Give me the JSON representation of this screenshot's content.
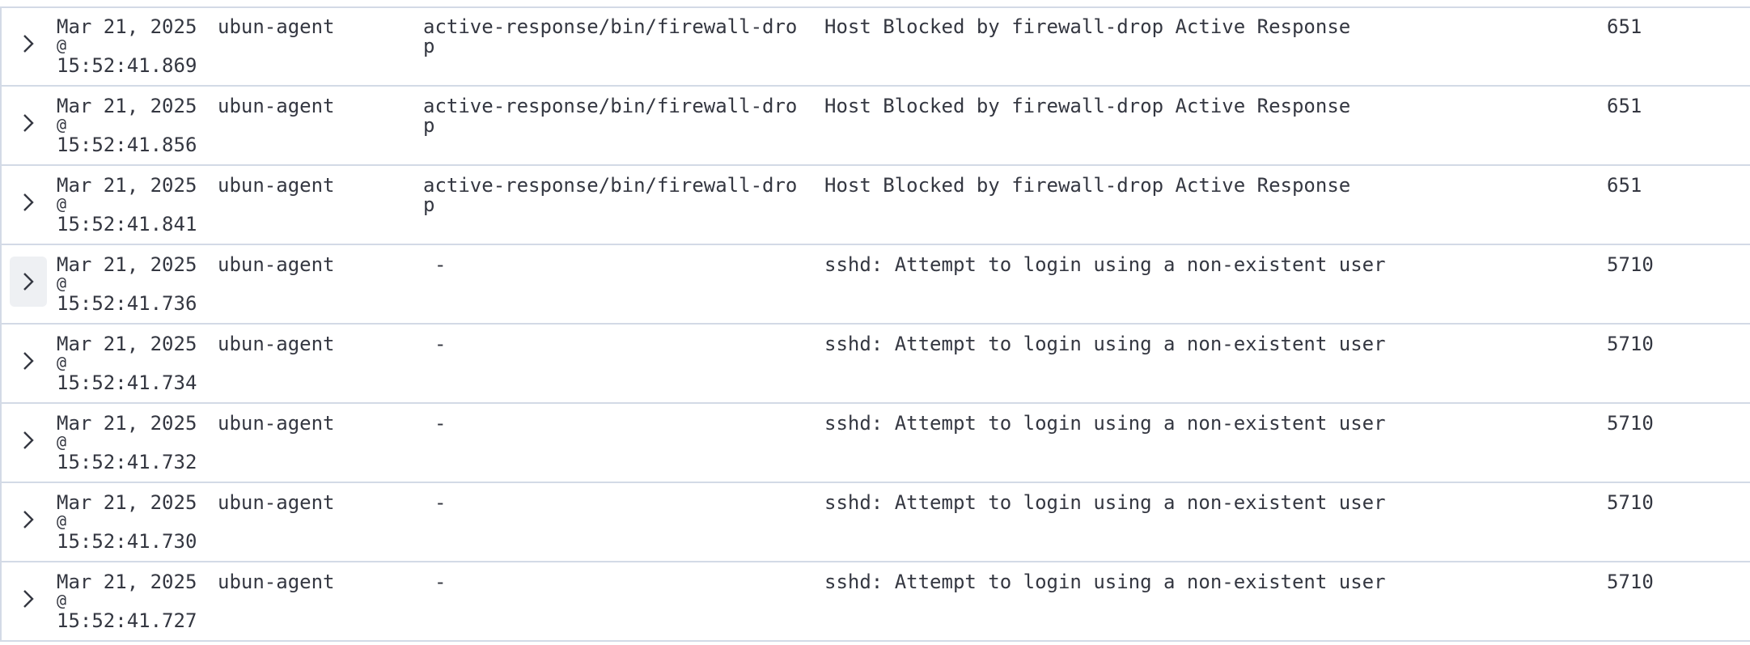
{
  "rows": [
    {
      "date": "Mar 21, 2025",
      "at": "@",
      "time": "15:52:41.869",
      "agent": "ubun-agent",
      "location": "active-response/bin/firewall-drop",
      "description": "Host Blocked by firewall-drop Active Response",
      "rule_id": "651"
    },
    {
      "date": "Mar 21, 2025",
      "at": "@",
      "time": "15:52:41.856",
      "agent": "ubun-agent",
      "location": "active-response/bin/firewall-drop",
      "description": "Host Blocked by firewall-drop Active Response",
      "rule_id": "651"
    },
    {
      "date": "Mar 21, 2025",
      "at": "@",
      "time": "15:52:41.841",
      "agent": "ubun-agent",
      "location": "active-response/bin/firewall-drop",
      "description": "Host Blocked by firewall-drop Active Response",
      "rule_id": "651"
    },
    {
      "date": "Mar 21, 2025",
      "at": "@",
      "time": "15:52:41.736",
      "agent": "ubun-agent",
      "location": "-",
      "description": "sshd: Attempt to login using a non-existent user",
      "rule_id": "5710"
    },
    {
      "date": "Mar 21, 2025",
      "at": "@",
      "time": "15:52:41.734",
      "agent": "ubun-agent",
      "location": "-",
      "description": "sshd: Attempt to login using a non-existent user",
      "rule_id": "5710"
    },
    {
      "date": "Mar 21, 2025",
      "at": "@",
      "time": "15:52:41.732",
      "agent": "ubun-agent",
      "location": "-",
      "description": "sshd: Attempt to login using a non-existent user",
      "rule_id": "5710"
    },
    {
      "date": "Mar 21, 2025",
      "at": "@",
      "time": "15:52:41.730",
      "agent": "ubun-agent",
      "location": "-",
      "description": "sshd: Attempt to login using a non-existent user",
      "rule_id": "5710"
    },
    {
      "date": "Mar 21, 2025",
      "at": "@",
      "time": "15:52:41.727",
      "agent": "ubun-agent",
      "location": "-",
      "description": "sshd: Attempt to login using a non-existent user",
      "rule_id": "5710"
    }
  ],
  "expand_icon": "chevron-right-icon",
  "focused_row_index": 3,
  "colors": {
    "text": "#343741",
    "border": "#d3dae6",
    "focus_bg": "#eef0f3"
  }
}
